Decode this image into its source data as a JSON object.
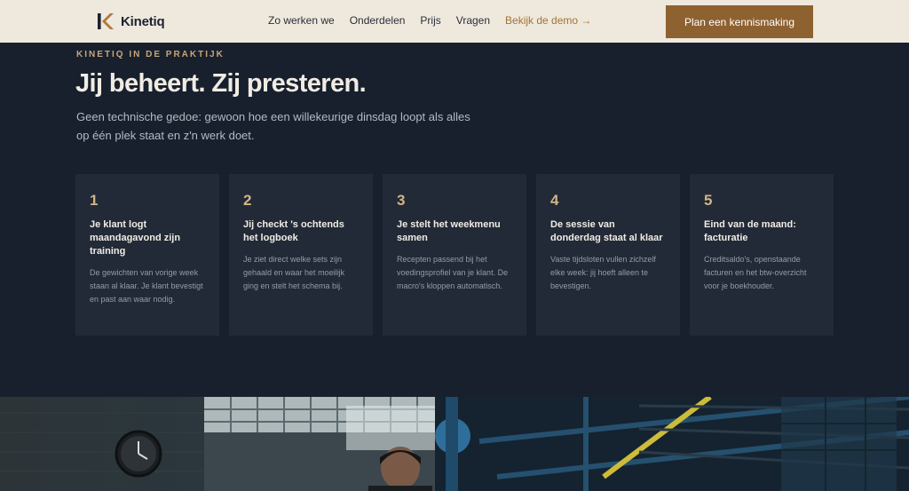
{
  "header": {
    "brand": "Kinetiq",
    "nav": [
      {
        "label": "Zo werken we"
      },
      {
        "label": "Onderdelen"
      },
      {
        "label": "Prijs"
      },
      {
        "label": "Vragen"
      },
      {
        "label": "Bekijk de demo →"
      }
    ],
    "cta_label": "Plan een kennismaking"
  },
  "intro": {
    "eyebrow": "KINETIQ IN DE PRAKTIJK",
    "title": "Jij beheert. Zij presteren.",
    "text": "Geen technische gedoe: gewoon hoe een willekeurige dinsdag loopt als alles op één plek staat en z'n werk doet."
  },
  "steps": [
    {
      "number": "1",
      "title": "Je klant logt maandagavond zijn training",
      "body": "De gewichten van vorige week staan al klaar. Je klant bevestigt en past aan waar nodig."
    },
    {
      "number": "2",
      "title": "Jij checkt 's ochtends het logboek",
      "body": "Je ziet direct welke sets zijn gehaald en waar het moeilijk ging en stelt het schema bij."
    },
    {
      "number": "3",
      "title": "Je stelt het weekmenu samen",
      "body": "Recepten passend bij het voedingsprofiel van je klant. De macro's kloppen automatisch."
    },
    {
      "number": "4",
      "title": "De sessie van donderdag staat al klaar",
      "body": "Vaste tijdsloten vullen zichzelf elke week: jij hoeft alleen te bevestigen."
    },
    {
      "number": "5",
      "title": "Eind van de maand: facturatie",
      "body": "Creditsaldo's, openstaande facturen en het btw-overzicht voor je boekhouder."
    }
  ],
  "colors": {
    "header_bg": "#efe8dd",
    "section_bg": "#18202e",
    "card_bg": "#222a38",
    "accent": "#8e6131",
    "accent_text": "#a27436",
    "number": "#d2b484"
  },
  "icons": {
    "logo": "kinetiq-k-logo-icon",
    "clock": "wall-clock-icon"
  }
}
